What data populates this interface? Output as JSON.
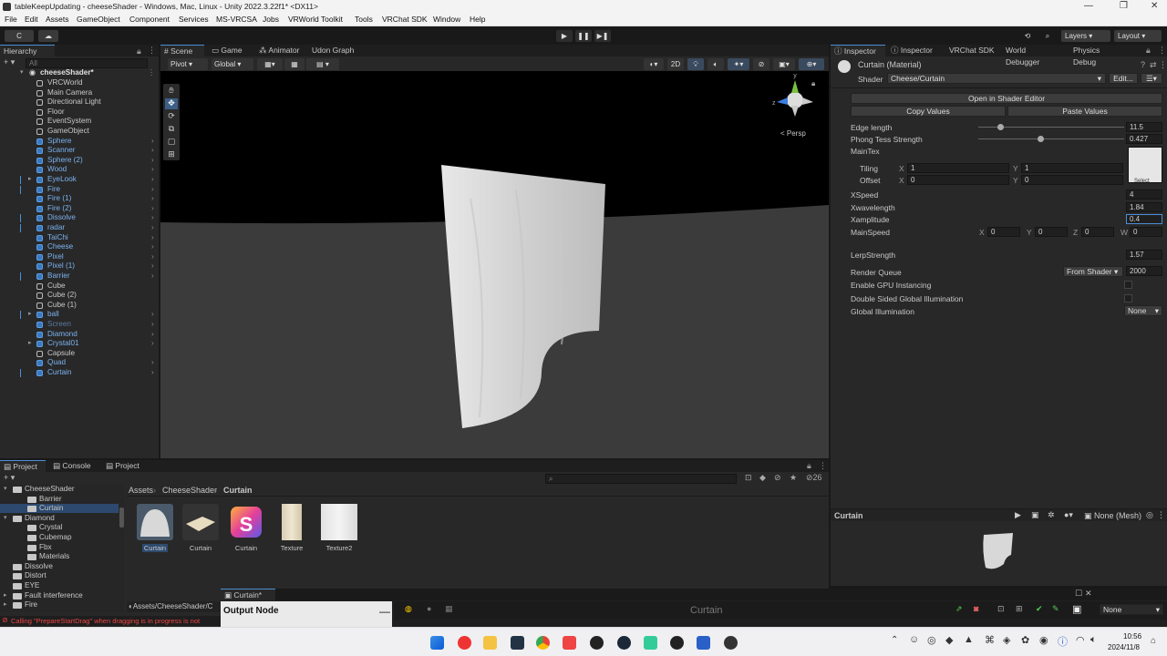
{
  "window": {
    "title": "tableKeepUpdating - cheeseShader - Windows, Mac, Linux - Unity 2022.3.22f1* <DX11>",
    "controls": [
      "—",
      "❐",
      "✕"
    ]
  },
  "menu": [
    "File",
    "Edit",
    "Assets",
    "GameObject",
    "Component",
    "Services",
    "MS-VRCSA",
    "Jobs",
    "VRWorld Toolkit",
    "Tools",
    "VRChat SDK",
    "Window",
    "Help"
  ],
  "toolbar": {
    "account": "C",
    "layers": "Layers",
    "layout": "Layout"
  },
  "hierarchy": {
    "tab": "Hierarchy",
    "search_placeholder": "All",
    "scene": "cheeseShader*",
    "items": [
      {
        "label": "VRCWorld",
        "prefab": false
      },
      {
        "label": "Main Camera",
        "prefab": false
      },
      {
        "label": "Directional Light",
        "prefab": false
      },
      {
        "label": "Floor",
        "prefab": false
      },
      {
        "label": "EventSystem",
        "prefab": false
      },
      {
        "label": "GameObject",
        "prefab": false
      },
      {
        "label": "Sphere",
        "prefab": true
      },
      {
        "label": "Scanner",
        "prefab": true
      },
      {
        "label": "Sphere (2)",
        "prefab": true
      },
      {
        "label": "Wood",
        "prefab": true
      },
      {
        "label": "EyeLook",
        "prefab": true
      },
      {
        "label": "Fire",
        "prefab": true
      },
      {
        "label": "Fire (1)",
        "prefab": true
      },
      {
        "label": "Fire (2)",
        "prefab": true
      },
      {
        "label": "Dissolve",
        "prefab": true
      },
      {
        "label": "radar",
        "prefab": true
      },
      {
        "label": "TaiChi",
        "prefab": true
      },
      {
        "label": "Cheese",
        "prefab": true
      },
      {
        "label": "Pixel",
        "prefab": true
      },
      {
        "label": "Pixel (1)",
        "prefab": true
      },
      {
        "label": "Barrier",
        "prefab": true
      },
      {
        "label": "Cube",
        "prefab": false
      },
      {
        "label": "Cube (2)",
        "prefab": false
      },
      {
        "label": "Cube (1)",
        "prefab": false
      },
      {
        "label": "ball",
        "prefab": true
      },
      {
        "label": "Screen",
        "prefab": true
      },
      {
        "label": "Diamond",
        "prefab": true
      },
      {
        "label": "Crystal01",
        "prefab": true
      },
      {
        "label": "Capsule",
        "prefab": false
      },
      {
        "label": "Quad",
        "prefab": true
      },
      {
        "label": "Curtain",
        "prefab": true
      }
    ]
  },
  "scene_tabs": [
    "Scene",
    "Game",
    "Animator",
    "Udon Graph"
  ],
  "scene_toolbar": {
    "pivot": "Pivot",
    "global": "Global",
    "mode_2d": "2D",
    "persp": "< Persp"
  },
  "inspector": {
    "tabs": [
      "Inspector",
      "Inspector",
      "VRChat SDK",
      "World Debugger",
      "Physics Debug"
    ],
    "material_title": "Curtain (Material)",
    "shader_label": "Shader",
    "shader_value": "Cheese/Curtain",
    "edit_button": "Edit...",
    "open_shader_editor": "Open in Shader Editor",
    "copy_values": "Copy Values",
    "paste_values": "Paste Values",
    "edge_length": {
      "label": "Edge length",
      "value": "11.5",
      "fraction": 0.15
    },
    "phong": {
      "label": "Phong Tess Strength",
      "value": "0.427",
      "fraction": 0.427
    },
    "main_tex": "MainTex",
    "tiling": {
      "label": "Tiling",
      "x": "1",
      "y": "1"
    },
    "offset": {
      "label": "Offset",
      "x": "0",
      "y": "0"
    },
    "select": "Select",
    "xspeed": {
      "label": "XSpeed",
      "value": "4"
    },
    "xwavelength": {
      "label": "Xwavelength",
      "value": "1.84"
    },
    "xamplitude": {
      "label": "Xamplitude",
      "value": "0.4"
    },
    "mainspeed": {
      "label": "MainSpeed",
      "x": "0",
      "y": "0",
      "z": "0",
      "w": "0"
    },
    "lerp": {
      "label": "LerpStrength",
      "value": "1.57"
    },
    "render_queue": {
      "label": "Render Queue",
      "mode": "From Shader",
      "value": "2000"
    },
    "gpu_instancing": "Enable GPU Instancing",
    "double_sided": "Double Sided Global Illumination",
    "gi": {
      "label": "Global Illumination",
      "value": "None"
    },
    "preview_title": "Curtain",
    "preview_mesh": "None (Mesh)"
  },
  "project": {
    "tabs": [
      "Project",
      "Console",
      "Project"
    ],
    "breadcrumb": [
      "Assets",
      "CheeseShader",
      "Curtain"
    ],
    "count": "26",
    "tree": [
      {
        "label": "CheeseShader",
        "indent": 0
      },
      {
        "label": "Barrier",
        "indent": 1
      },
      {
        "label": "Curtain",
        "indent": 1
      },
      {
        "label": "Diamond",
        "indent": 0
      },
      {
        "label": "Crystal",
        "indent": 1
      },
      {
        "label": "Cubemap",
        "indent": 1
      },
      {
        "label": "Fbx",
        "indent": 1
      },
      {
        "label": "Materials",
        "indent": 1
      },
      {
        "label": "Dissolve",
        "indent": 0
      },
      {
        "label": "Distort",
        "indent": 0
      },
      {
        "label": "EYE",
        "indent": 0
      },
      {
        "label": "Fault interference",
        "indent": 0
      },
      {
        "label": "Fire",
        "indent": 0
      }
    ],
    "assets": [
      "Curtain",
      "Curtain",
      "Curtain",
      "Texture",
      "Texture2"
    ],
    "path": "Assets/CheeseShader/C"
  },
  "shadergraph": {
    "tab": "Curtain*",
    "output": "Output Node",
    "name": "Curtain",
    "none": "None"
  },
  "console_error": "Calling \"PrepareStartDrag\" when dragging is in progress is not",
  "clock": {
    "time": "10:56",
    "date": "2024/11/8"
  }
}
